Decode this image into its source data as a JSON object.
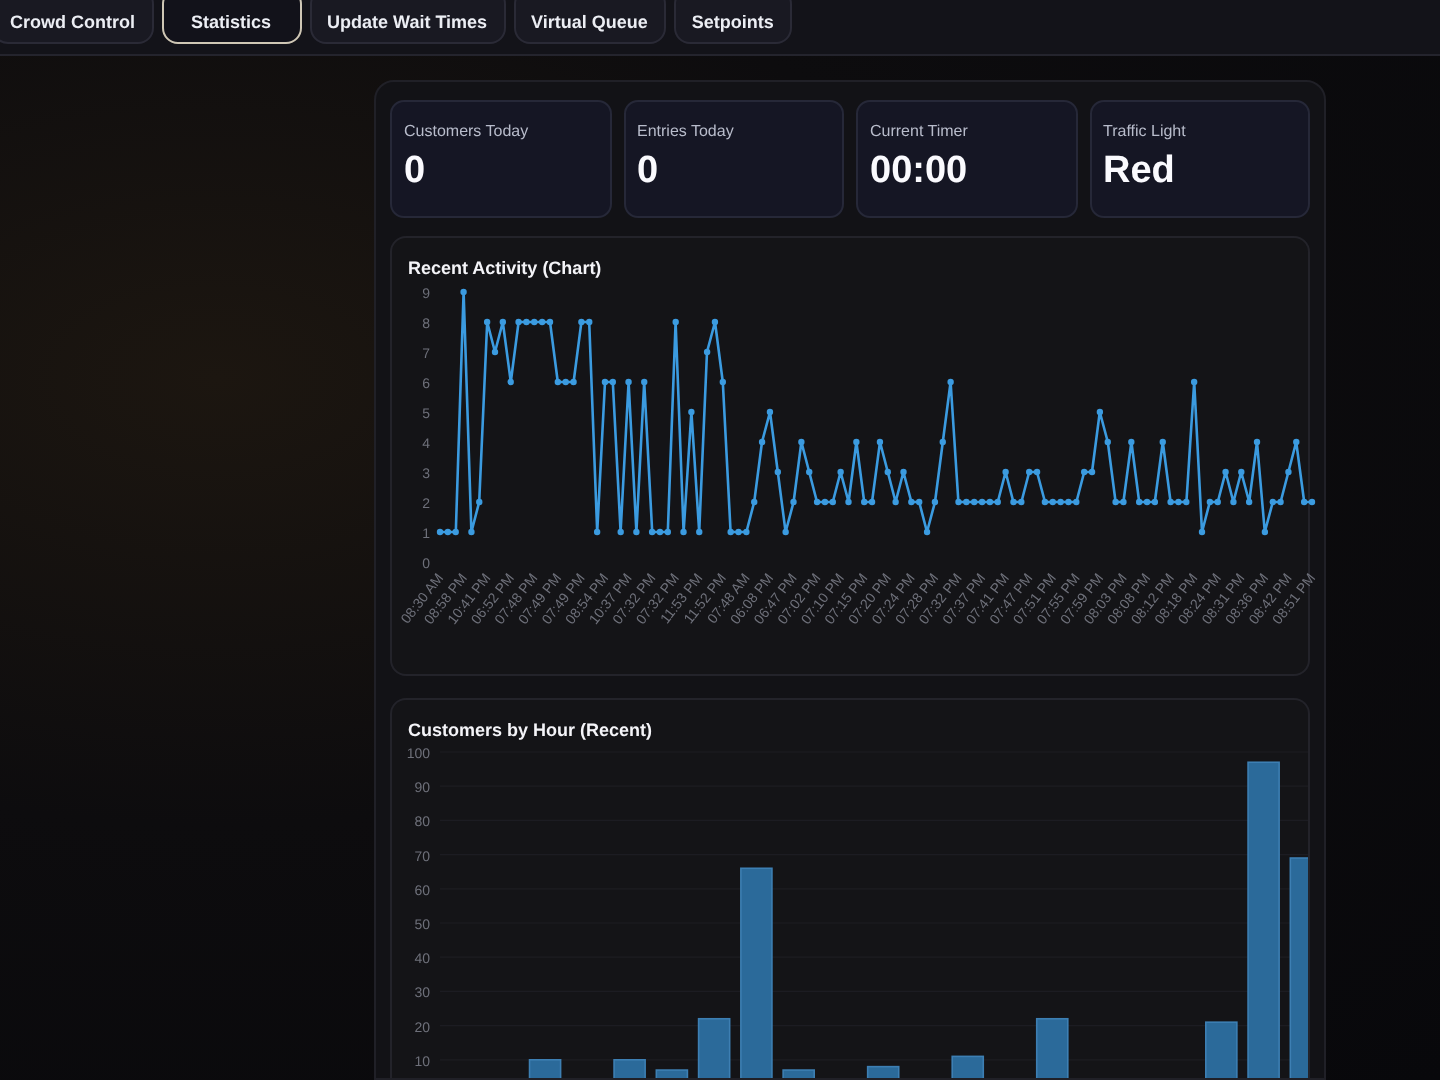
{
  "tabs": [
    {
      "label": "Crowd Control",
      "selected": false
    },
    {
      "label": "Statistics",
      "selected": true
    },
    {
      "label": "Update Wait Times",
      "selected": false
    },
    {
      "label": "Virtual Queue",
      "selected": false
    },
    {
      "label": "Setpoints",
      "selected": false
    }
  ],
  "stats": [
    {
      "label": "Customers Today",
      "value": "0"
    },
    {
      "label": "Entries Today",
      "value": "0"
    },
    {
      "label": "Current Timer",
      "value": "00:00"
    },
    {
      "label": "Traffic Light",
      "value": "Red"
    }
  ],
  "activity_chart": {
    "title": "Recent Activity (Chart)",
    "chart_data": {
      "type": "line",
      "ylim": [
        0,
        9
      ],
      "yticks": [
        0,
        1,
        2,
        3,
        4,
        5,
        6,
        7,
        8,
        9
      ],
      "series": [
        {
          "color": "#3b9be0",
          "marker": "circle",
          "values": [
            1,
            1,
            1,
            9,
            1,
            2,
            8,
            7,
            8,
            6,
            8,
            8,
            8,
            8,
            8,
            6,
            6,
            6,
            8,
            8,
            1,
            6,
            6,
            1,
            6,
            1,
            6,
            1,
            1,
            1,
            8,
            1,
            5,
            1,
            7,
            8,
            6,
            1,
            1,
            1,
            2,
            4,
            5,
            3,
            1,
            2,
            4,
            3,
            2,
            2,
            2,
            3,
            2,
            4,
            2,
            2,
            4,
            3,
            2,
            3,
            2,
            2,
            1,
            2,
            4,
            6,
            2,
            2,
            2,
            2,
            2,
            2,
            3,
            2,
            2,
            3,
            3,
            2,
            2,
            2,
            2,
            2,
            3,
            3,
            5,
            4,
            2,
            2,
            4,
            2,
            2,
            2,
            4,
            2,
            2,
            2,
            6,
            1,
            2,
            2,
            3,
            2,
            3,
            2,
            4,
            1,
            2,
            2,
            3,
            4,
            2,
            2
          ]
        }
      ],
      "categories": [
        "08:30 AM",
        null,
        null,
        "08:58 PM",
        null,
        null,
        "10:41 PM",
        null,
        null,
        "06:52 PM",
        null,
        null,
        "07:48 PM",
        null,
        null,
        "07:49 PM",
        null,
        null,
        "07:49 PM",
        null,
        null,
        "08:54 PM",
        null,
        null,
        "10:37 PM",
        null,
        null,
        "07:32 PM",
        null,
        null,
        "07:32 PM",
        null,
        null,
        "11:53 PM",
        null,
        null,
        "11:52 PM",
        null,
        null,
        "07:48 AM",
        null,
        null,
        "06:08 PM",
        null,
        null,
        "06:47 PM",
        null,
        null,
        "07:02 PM",
        null,
        null,
        "07:10 PM",
        null,
        null,
        "07:15 PM",
        null,
        null,
        "07:20 PM",
        null,
        null,
        "07:24 PM",
        null,
        null,
        "07:28 PM",
        null,
        null,
        "07:32 PM",
        null,
        null,
        "07:37 PM",
        null,
        null,
        "07:41 PM",
        null,
        null,
        "07:47 PM",
        null,
        null,
        "07:51 PM",
        null,
        null,
        "07:55 PM",
        null,
        null,
        "07:59 PM",
        null,
        null,
        "08:03 PM",
        null,
        null,
        "08:08 PM",
        null,
        null,
        "08:12 PM",
        null,
        null,
        "08:18 PM",
        null,
        null,
        "08:24 PM",
        null,
        null,
        "08:31 PM",
        null,
        null,
        "08:36 PM",
        null,
        null,
        "08:42 PM",
        null,
        null,
        "08:51 PM"
      ]
    }
  },
  "hourly_chart": {
    "title": "Customers by Hour (Recent)",
    "chart_data": {
      "type": "bar",
      "grid": true,
      "ylim": [
        0,
        100
      ],
      "yticks": [
        10,
        20,
        30,
        40,
        50,
        60,
        70,
        80,
        90,
        100
      ],
      "series": [
        {
          "color": "#2b6a9a",
          "values": [
            null,
            null,
            10,
            null,
            10,
            7,
            22,
            66,
            7,
            null,
            8,
            null,
            11,
            null,
            22,
            null,
            null,
            null,
            21,
            97,
            69
          ]
        }
      ]
    }
  }
}
